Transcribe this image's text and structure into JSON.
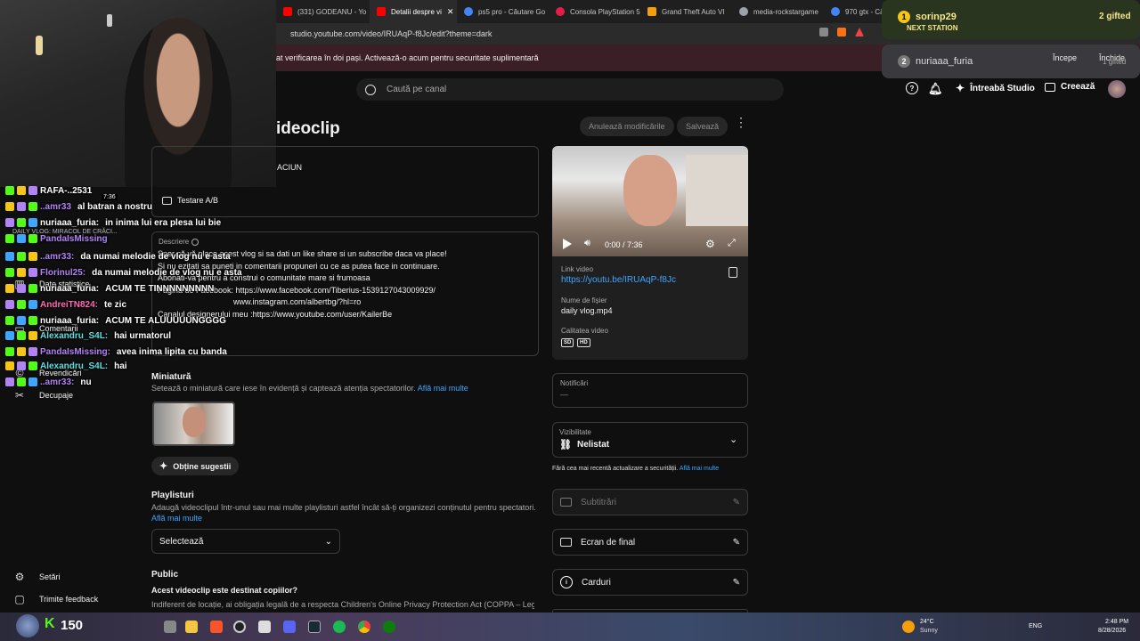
{
  "browser": {
    "tabs": [
      {
        "label": "(331) GODEANU - Yo",
        "color": "#ff0000"
      },
      {
        "label": "Detalii despre vi",
        "color": "#ff0000",
        "active": true
      },
      {
        "label": "ps5 pro - Căutare Go",
        "color": "#4285f4"
      },
      {
        "label": "Consola PlayStation 5",
        "color": "#e11d48"
      },
      {
        "label": "Grand Theft Auto VI",
        "color": "#f59e0b"
      },
      {
        "label": "media-rockstargame",
        "color": "#9ca3af"
      },
      {
        "label": "970 gtx - Căutare",
        "color": "#4285f4"
      }
    ],
    "url": "studio.youtube.com/video/IRUAqP-f8Jc/edit?theme=dark",
    "warning": "at verificarea în doi pași. Activează-o acum pentru securitate suplimentară"
  },
  "header": {
    "search_placeholder": "Caută pe canal",
    "ask_studio": "Întreabă Studio",
    "create": "Creează"
  },
  "page": {
    "title": "ideoclip",
    "undo_button": "Anulează modificările",
    "save_button": "Salvează",
    "title_value": "ACIUN",
    "ab_test": "Testare A/B",
    "description_label": "Descriere",
    "description_lines": [
      "Sper că vă place acest vlog si sa dati un like share si un subscribe daca va place!",
      "Si nu ezitati sa puneti in comentarii propuneri cu ce as putea face in continuare.",
      "Abonati-va pentru a construi o comunitate mare si frumoasa",
      "Pagina de Facebook: https://www.facebook.com/Tiberius-1539127043009929/",
      "www.instagram.com/albertbg/?hl=ro",
      "Canalul designerului meu :https://www.youtube.com/user/KailerBe"
    ],
    "thumbnail_title": "Miniatură",
    "thumbnail_desc": "Setează o miniatură care iese în evidență și captează atenția spectatorilor.",
    "learn_more": "Află mai multe",
    "suggest_button": "Obține sugestii",
    "playlists_title": "Playlisturi",
    "playlists_desc": "Adaugă videoclipul într-unul sau mai multe playlisturi astfel încât să-ți organizezi conținutul pentru spectatori.",
    "playlists_select": "Selectează",
    "public_title": "Public",
    "kids_question": "Acest videoclip este destinat copiilor?",
    "kids_desc": "Indiferent de locație, ai obligația legală de a respecta Children's Online Privacy Protection Act (COPPA – Legea"
  },
  "video": {
    "time": "0:00 / 7:36",
    "link_label": "Link video",
    "link": "https://youtu.be/IRUAqP-f8Jc",
    "file_label": "Nume de fișier",
    "file": "daily vlog.mp4",
    "quality_label": "Calitatea video",
    "quality_sd": "SD",
    "quality_hd": "HD"
  },
  "right": {
    "notifications_label": "Notificări",
    "notifications_value": "—",
    "visibility_label": "Vizibilitate",
    "visibility_value": "Nelistat",
    "security_note": "Fără cea mai recentă actualizare a securității.",
    "subtitles": "Subtitrări",
    "end_screen": "Ecran de final",
    "cards": "Carduri"
  },
  "sidebar": {
    "items": [
      {
        "label": "Date statistice",
        "icon": "chart-icon"
      },
      {
        "label": "Comentarii",
        "icon": "comment-icon"
      },
      {
        "label": "Revendicări",
        "icon": "claim-icon"
      },
      {
        "label": "Decupaje",
        "icon": "scissors-icon"
      }
    ],
    "settings": "Setări",
    "feedback": "Trimite feedback",
    "mini_video_title": "DAILY VLOG: MIRACOL DE CRĂCI...",
    "mini_video_time": "7:36"
  },
  "chat": [
    {
      "user": "RAFA-..2531",
      "msg": "",
      "ucolor": "#ffffff"
    },
    {
      "user": "..amr33",
      "msg": "al batran a nostru",
      "ucolor": "#b084f5"
    },
    {
      "user": "nuriaaa_furia:",
      "msg": "in inima lui era plesa lui bie",
      "ucolor": "#ffffff"
    },
    {
      "user": "PandaIsMissing",
      "msg": "",
      "ucolor": "#b084f5"
    },
    {
      "user": "..amr33:",
      "msg": "da numai melodie de vlog nu e asta",
      "ucolor": "#b084f5"
    },
    {
      "user": "Florinul25:",
      "msg": "da numai melodie de vlog nu e asta",
      "ucolor": "#b084f5"
    },
    {
      "user": "nuriaaa_furia:",
      "msg": "ACUM TE TINNNNNNNNN",
      "ucolor": "#ffffff"
    },
    {
      "user": "AndreiTN824:",
      "msg": "te zic",
      "ucolor": "#ff69b4"
    },
    {
      "user": "nuriaaa_furia:",
      "msg": "ACUM TE ALUUUUUNGGGG",
      "ucolor": "#ffffff"
    },
    {
      "user": "Alexandru_S4L:",
      "msg": "hai urmatorul",
      "ucolor": "#5ee0e0"
    },
    {
      "user": "PandaIsMissing:",
      "msg": "avea inima lipita cu banda",
      "ucolor": "#b084f5"
    },
    {
      "user": "Alexandru_S4L:",
      "msg": "hai",
      "ucolor": "#5ee0e0"
    },
    {
      "user": "..amr33:",
      "msg": "nu",
      "ucolor": "#b084f5"
    }
  ],
  "overlay": {
    "rank1": "1",
    "user1": "sorinp29",
    "station": "NEXT STATION",
    "gifted": "2 gifted",
    "rank2": "2",
    "user2": "nuriaaa_furia",
    "start": "Începe",
    "close": "Închide",
    "gifted2": "1 gifted",
    "points": "150"
  },
  "taskbar": {
    "temp": "24°C",
    "weather": "Sunny",
    "lang": "ENG",
    "time": "2:48 PM",
    "date": "8/28/2026"
  }
}
